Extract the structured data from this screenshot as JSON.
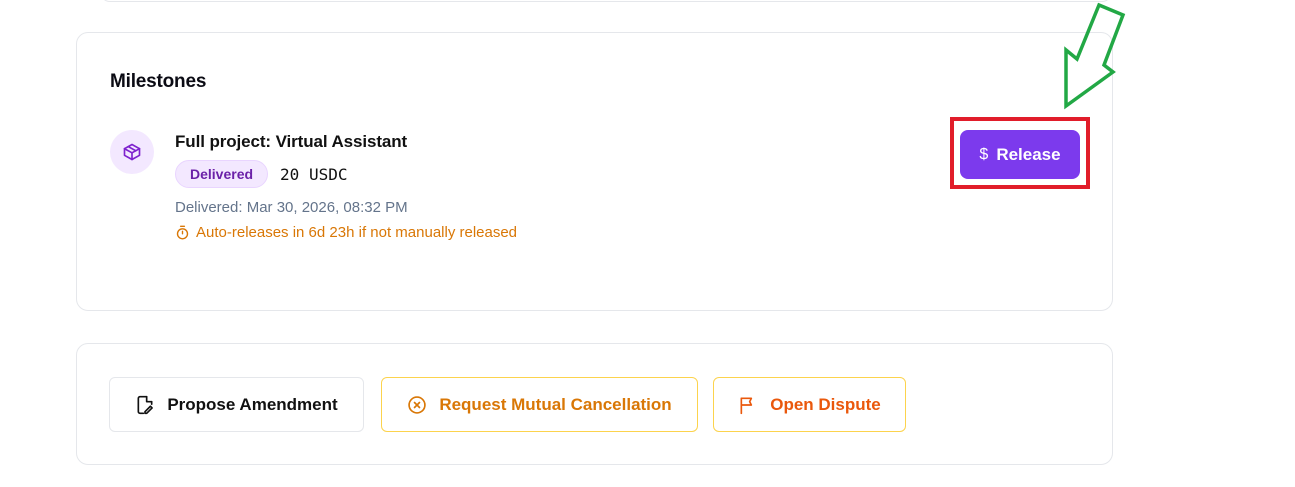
{
  "milestones": {
    "title": "Milestones",
    "items": [
      {
        "title": "Full project: Virtual Assistant",
        "status": "Delivered",
        "amount": "20 USDC",
        "delivered_at": "Delivered: Mar 30, 2026, 08:32 PM",
        "auto_release": "Auto-releases in 6d 23h if not manually released",
        "icon": "package-icon",
        "action_label": "Release",
        "action_icon": "$"
      }
    ]
  },
  "actions": {
    "propose_amendment": "Propose Amendment",
    "request_cancellation": "Request Mutual Cancellation",
    "open_dispute": "Open Dispute"
  },
  "colors": {
    "accent": "#7c3aed",
    "badge_bg": "#f3e8ff",
    "badge_text": "#6b21a8",
    "warning": "#d97706",
    "dispute": "#ea580c",
    "highlight_box": "#e11d2a",
    "annotation_arrow": "#22a845"
  }
}
